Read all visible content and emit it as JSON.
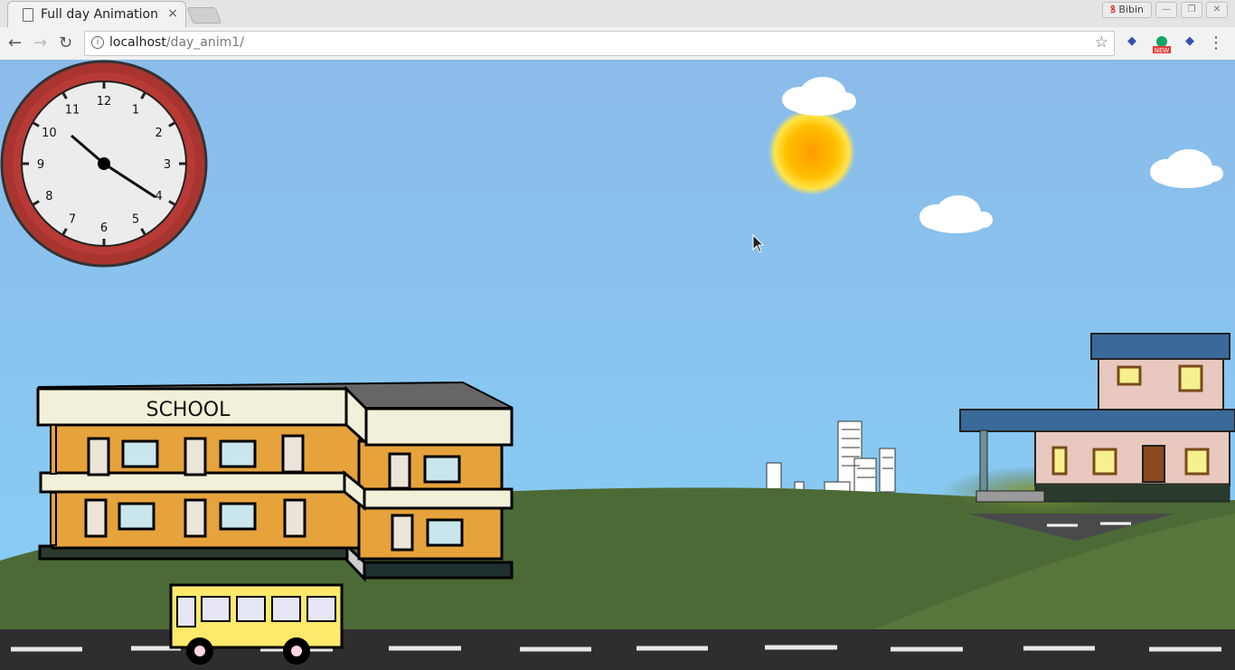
{
  "browser": {
    "tab_title": "Full day Animation",
    "tab_close": "×",
    "profile": "Bibin",
    "url_host": "localhost",
    "url_path": "/day_anim1/",
    "ext_badge": "NEW"
  },
  "scene": {
    "school_sign": "SCHOOL",
    "clock_numbers": [
      "12",
      "1",
      "2",
      "3",
      "4",
      "5",
      "6",
      "7",
      "8",
      "9",
      "10",
      "11"
    ],
    "clock_time": "10:20",
    "colors": {
      "sky_top": "#8bbfea",
      "sky_bottom": "#87cdf4",
      "grass": "#4c6a35",
      "road": "#2e2e30",
      "sun": "#ffb000",
      "school_wall": "#e6a33c",
      "bus": "#ffe96b",
      "house_roof": "#3a6a9a",
      "house_wall": "#e8c8bf"
    }
  }
}
